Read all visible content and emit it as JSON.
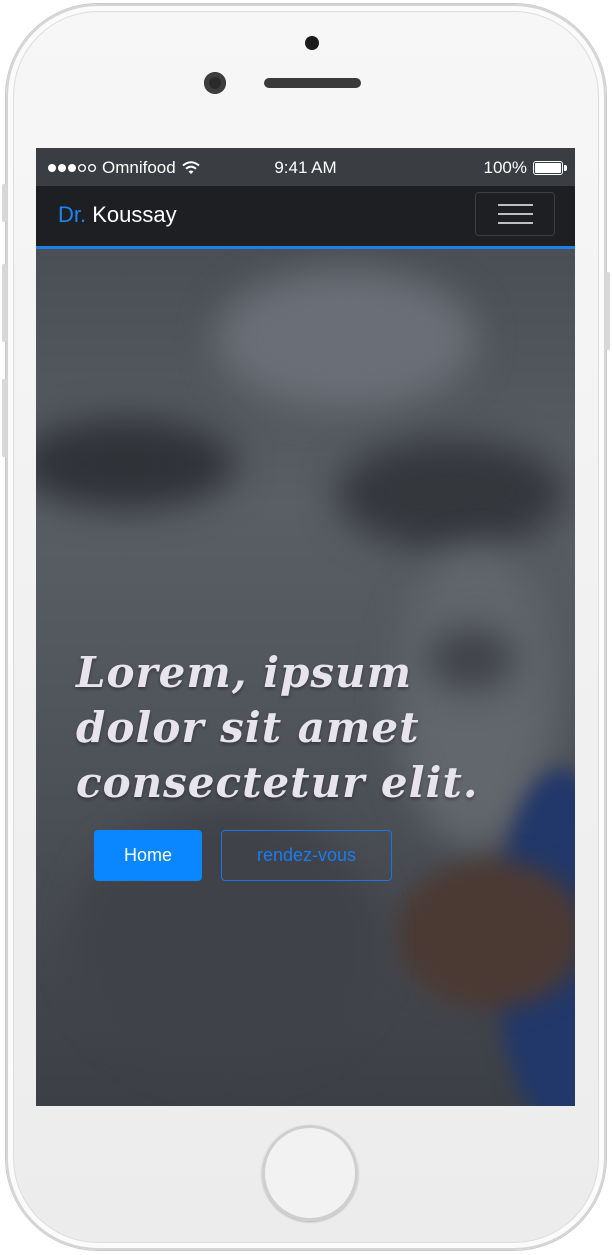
{
  "statusbar": {
    "carrier": "Omnifood",
    "time": "9:41 AM",
    "battery": "100%",
    "signal_icon": "signal-dots-icon",
    "wifi_icon": "wifi-icon",
    "battery_icon": "battery-icon"
  },
  "navbar": {
    "brand_prefix": "Dr.",
    "brand_name": " Koussay",
    "menu_icon": "hamburger-menu-icon"
  },
  "hero": {
    "title_lines": [
      "Lorem, ipsum",
      "dolor sit amet",
      "consectetur elit."
    ],
    "primary_button": "Home",
    "secondary_button": "rendez-vous"
  },
  "colors": {
    "accent": "#1e83f3",
    "primary_button_bg": "#0a87ff",
    "navbar_bg": "#1d1f22"
  }
}
